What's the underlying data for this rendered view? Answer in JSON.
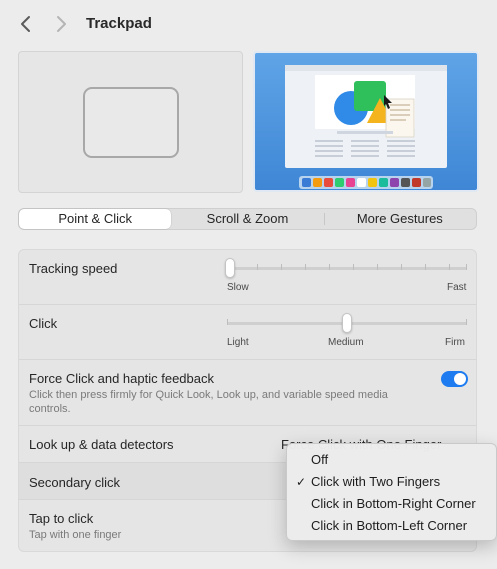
{
  "window": {
    "title": "Trackpad"
  },
  "tabs": [
    {
      "label": "Point & Click",
      "active": true
    },
    {
      "label": "Scroll & Zoom",
      "active": false
    },
    {
      "label": "More Gestures",
      "active": false
    }
  ],
  "settings": {
    "tracking_speed": {
      "label": "Tracking speed",
      "min_label": "Slow",
      "max_label": "Fast",
      "value_fraction": 0.0
    },
    "click": {
      "label": "Click",
      "labels": [
        "Light",
        "Medium",
        "Firm"
      ],
      "value": "Medium"
    },
    "force_click": {
      "label": "Force Click and haptic feedback",
      "description": "Click then press firmly for Quick Look, Look up, and variable speed media controls.",
      "enabled": true
    },
    "look_up": {
      "label": "Look up & data detectors",
      "value": "Force Click with One Finger"
    },
    "secondary_click": {
      "label": "Secondary click"
    },
    "tap_to_click": {
      "label": "Tap to click",
      "description": "Tap with one finger"
    }
  },
  "secondary_click_menu": {
    "selected": "Click with Two Fingers",
    "options": [
      "Off",
      "Click with Two Fingers",
      "Click in Bottom-Right Corner",
      "Click in Bottom-Left Corner"
    ]
  },
  "colors": {
    "accent": "#1f7cf0",
    "preview_bg": "#4a90dc"
  }
}
